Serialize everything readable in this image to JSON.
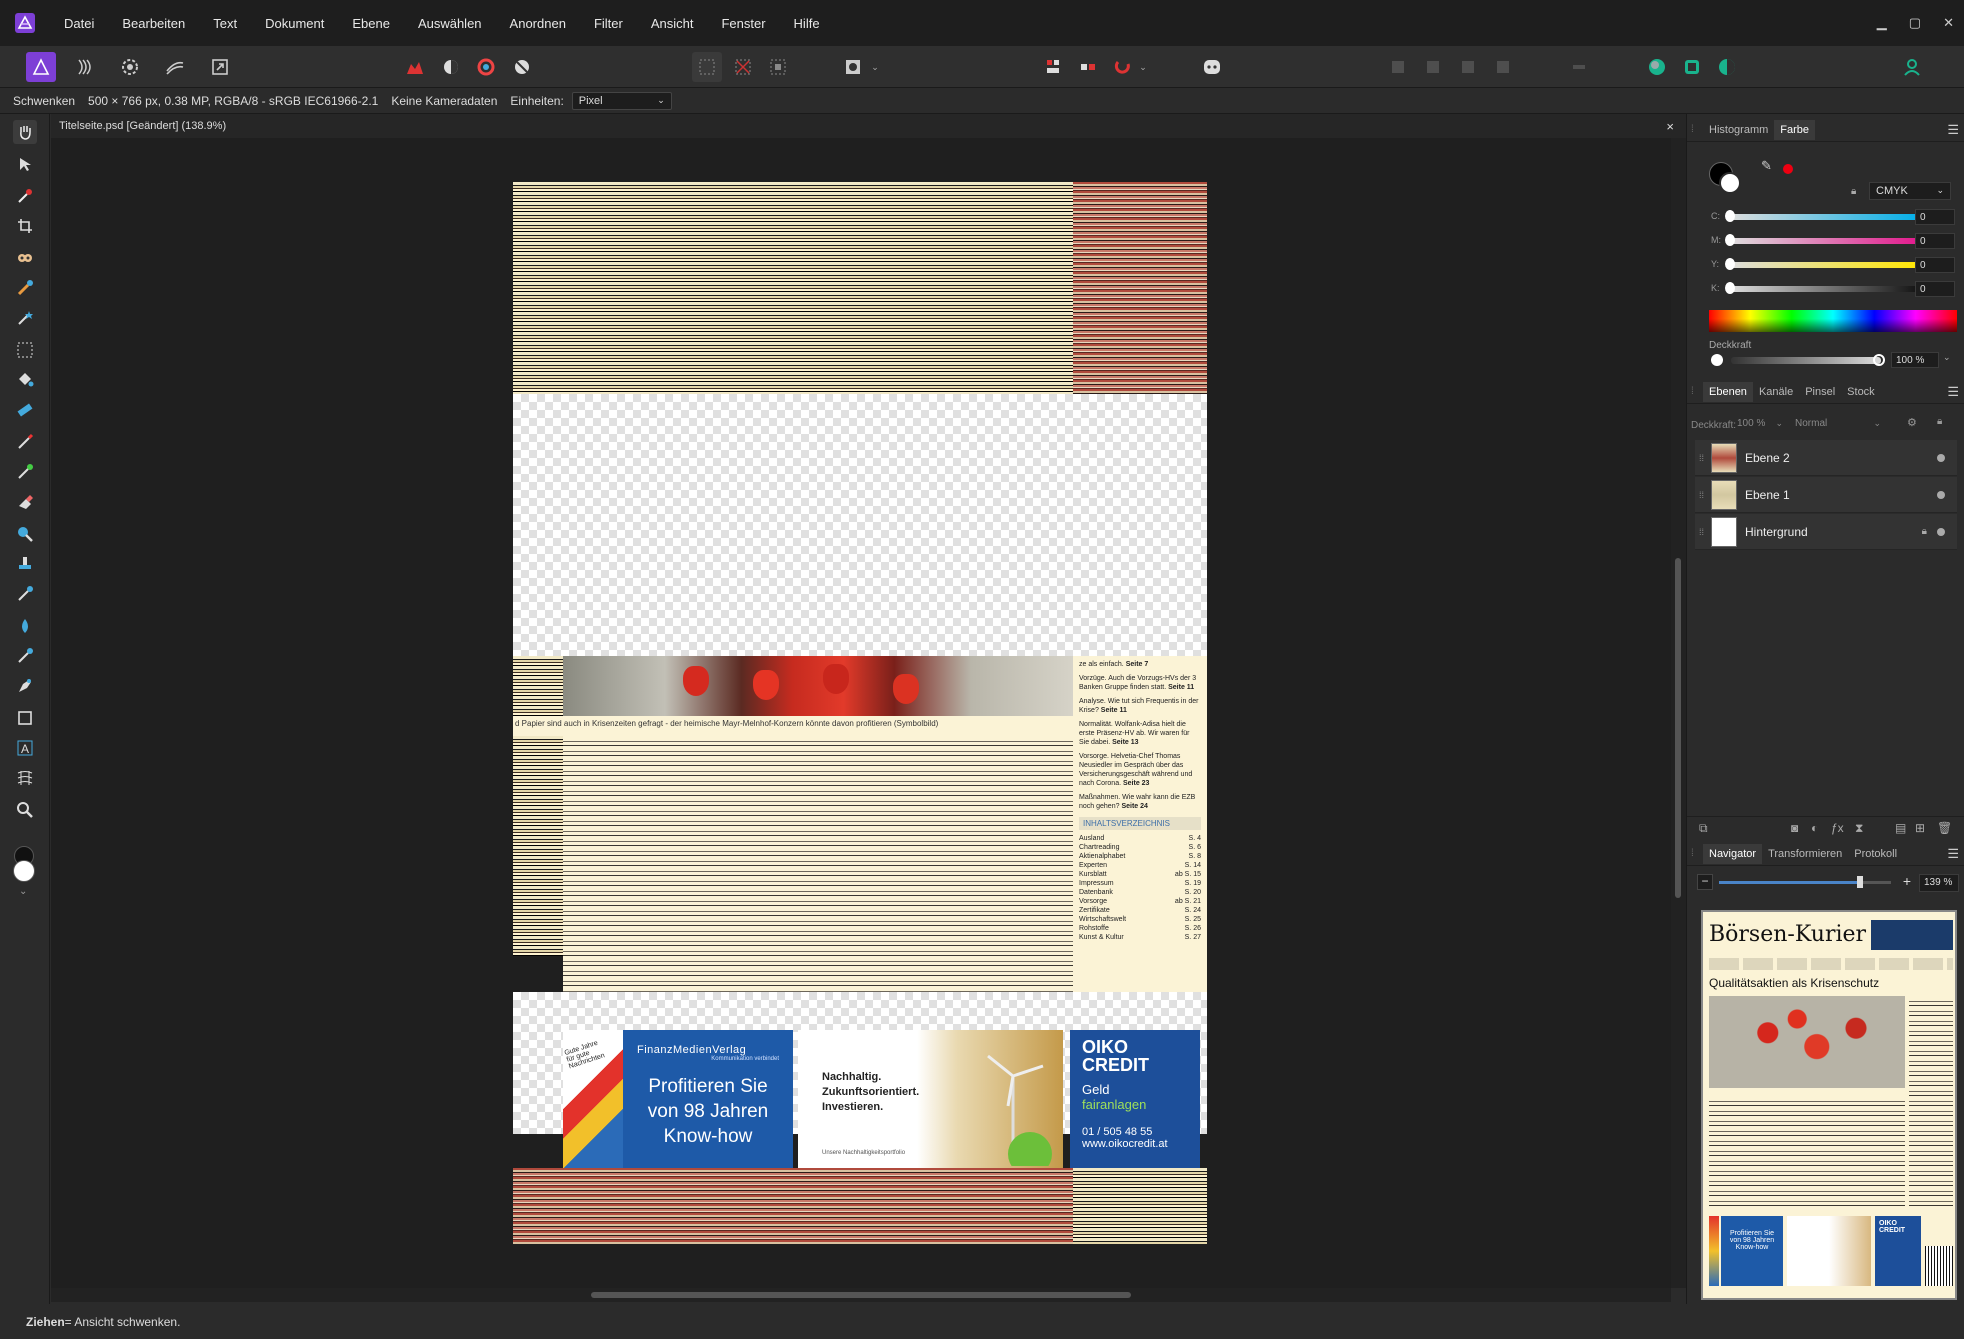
{
  "menubar": {
    "items": [
      "Datei",
      "Bearbeiten",
      "Text",
      "Dokument",
      "Ebene",
      "Auswählen",
      "Anordnen",
      "Filter",
      "Ansicht",
      "Fenster",
      "Hilfe"
    ]
  },
  "context": {
    "tool": "Schwenken",
    "docinfo": "500 × 766 px, 0.38 MP, RGBA/8 - sRGB IEC61966-2.1",
    "camera": "Keine Kameradaten",
    "units_label": "Einheiten:",
    "units_value": "Pixel"
  },
  "document": {
    "tab_title": "Titelseite.psd [Geändert] (138.9%)",
    "close": "×"
  },
  "doc_content": {
    "caption": "d Papier sind auch in Krisenzeiten gefragt - der heimische Mayr-Melnhof-Konzern könnte davon profitieren (Symbolbild)",
    "sidebar_items": [
      {
        "text": "ze als einfach.",
        "page": "Seite 7"
      },
      {
        "text": "Vorzüge. Auch die Vorzugs-HVs der 3 Banken Gruppe finden statt.",
        "page": "Seite 11"
      },
      {
        "text": "Analyse. Wie tut sich Frequentis in der Krise?",
        "page": "Seite 11"
      },
      {
        "text": "Normalität. Wolfank-Adisa hielt die erste Präsenz-HV ab. Wir waren für Sie dabei.",
        "page": "Seite 13"
      },
      {
        "text": "Vorsorge. Helvetia-Chef Thomas Neusiedler im Gespräch über das Versicherungsgeschäft während und nach Corona.",
        "page": "Seite 23"
      },
      {
        "text": "Maßnahmen. Wie wahr kann die EZB noch gehen?",
        "page": "Seite 24"
      }
    ],
    "toc_title": "INHALTSVERZEICHNIS",
    "toc": [
      [
        "Ausland",
        "S. 4"
      ],
      [
        "Chartreading",
        "S. 6"
      ],
      [
        "Aktienalphabet",
        "S. 8"
      ],
      [
        "Experten",
        "S. 14"
      ],
      [
        "Kursblatt",
        "ab S. 15"
      ],
      [
        "Impressum",
        "S. 19"
      ],
      [
        "Datenbank",
        "S. 20"
      ],
      [
        "Vorsorge",
        "ab S. 21"
      ],
      [
        "Zertifikate",
        "S. 24"
      ],
      [
        "Wirtschaftswelt",
        "S. 25"
      ],
      [
        "Rohstoffe",
        "S. 26"
      ],
      [
        "Kunst & Kultur",
        "S. 27"
      ]
    ],
    "ad1": {
      "brand": "FinanzMedienVerlag",
      "sub": "Kommunikation verbindet",
      "headline": "Profitieren Sie von 98 Jahren Know-how"
    },
    "ad_left": "Gute Jahre für gute Nachrichten",
    "ad2": {
      "headline": "Nachhaltig. Zukunftsorientiert. Investieren.",
      "small": "Unsere Nachhaltigkeitsportfolio"
    },
    "ad3": {
      "brand": "OIKO CREDIT",
      "line1": "Geld",
      "line2": "fairanlagen",
      "phone": "01 / 505 48 55",
      "url": "www.oikocredit.at"
    }
  },
  "panels": {
    "top_tabs": [
      "Histogramm",
      "Farbe"
    ],
    "color_model": "CMYK",
    "cmyk": [
      {
        "label": "C:",
        "value": "0"
      },
      {
        "label": "M:",
        "value": "0"
      },
      {
        "label": "Y:",
        "value": "0"
      },
      {
        "label": "K:",
        "value": "0"
      }
    ],
    "opacity_label": "Deckkraft",
    "opacity_value": "100 %",
    "layer_tabs": [
      "Ebenen",
      "Kanäle",
      "Pinsel",
      "Stock"
    ],
    "layer_opacity_label": "Deckkraft:",
    "layer_opacity_value": "100 %",
    "blend_mode": "Normal",
    "layers": [
      "Ebene 2",
      "Ebene 1",
      "Hintergrund"
    ],
    "nav_tabs": [
      "Navigator",
      "Transformieren",
      "Protokoll"
    ],
    "zoom": "139 %",
    "navigator": {
      "masthead": "Börsen-Kurier",
      "headline": "Qualitätsaktien als Krisenschutz",
      "ad1": "Profitieren Sie von 98 Jahren Know-how",
      "ad3": "OIKO CREDIT"
    }
  },
  "status": {
    "bold": "Ziehen",
    "text": " = Ansicht schwenken."
  },
  "colors": {
    "accent": "#7d3fd6",
    "teal": "#19b38d",
    "menubar": "#1e1e1e",
    "panel": "#2b2b2b"
  }
}
